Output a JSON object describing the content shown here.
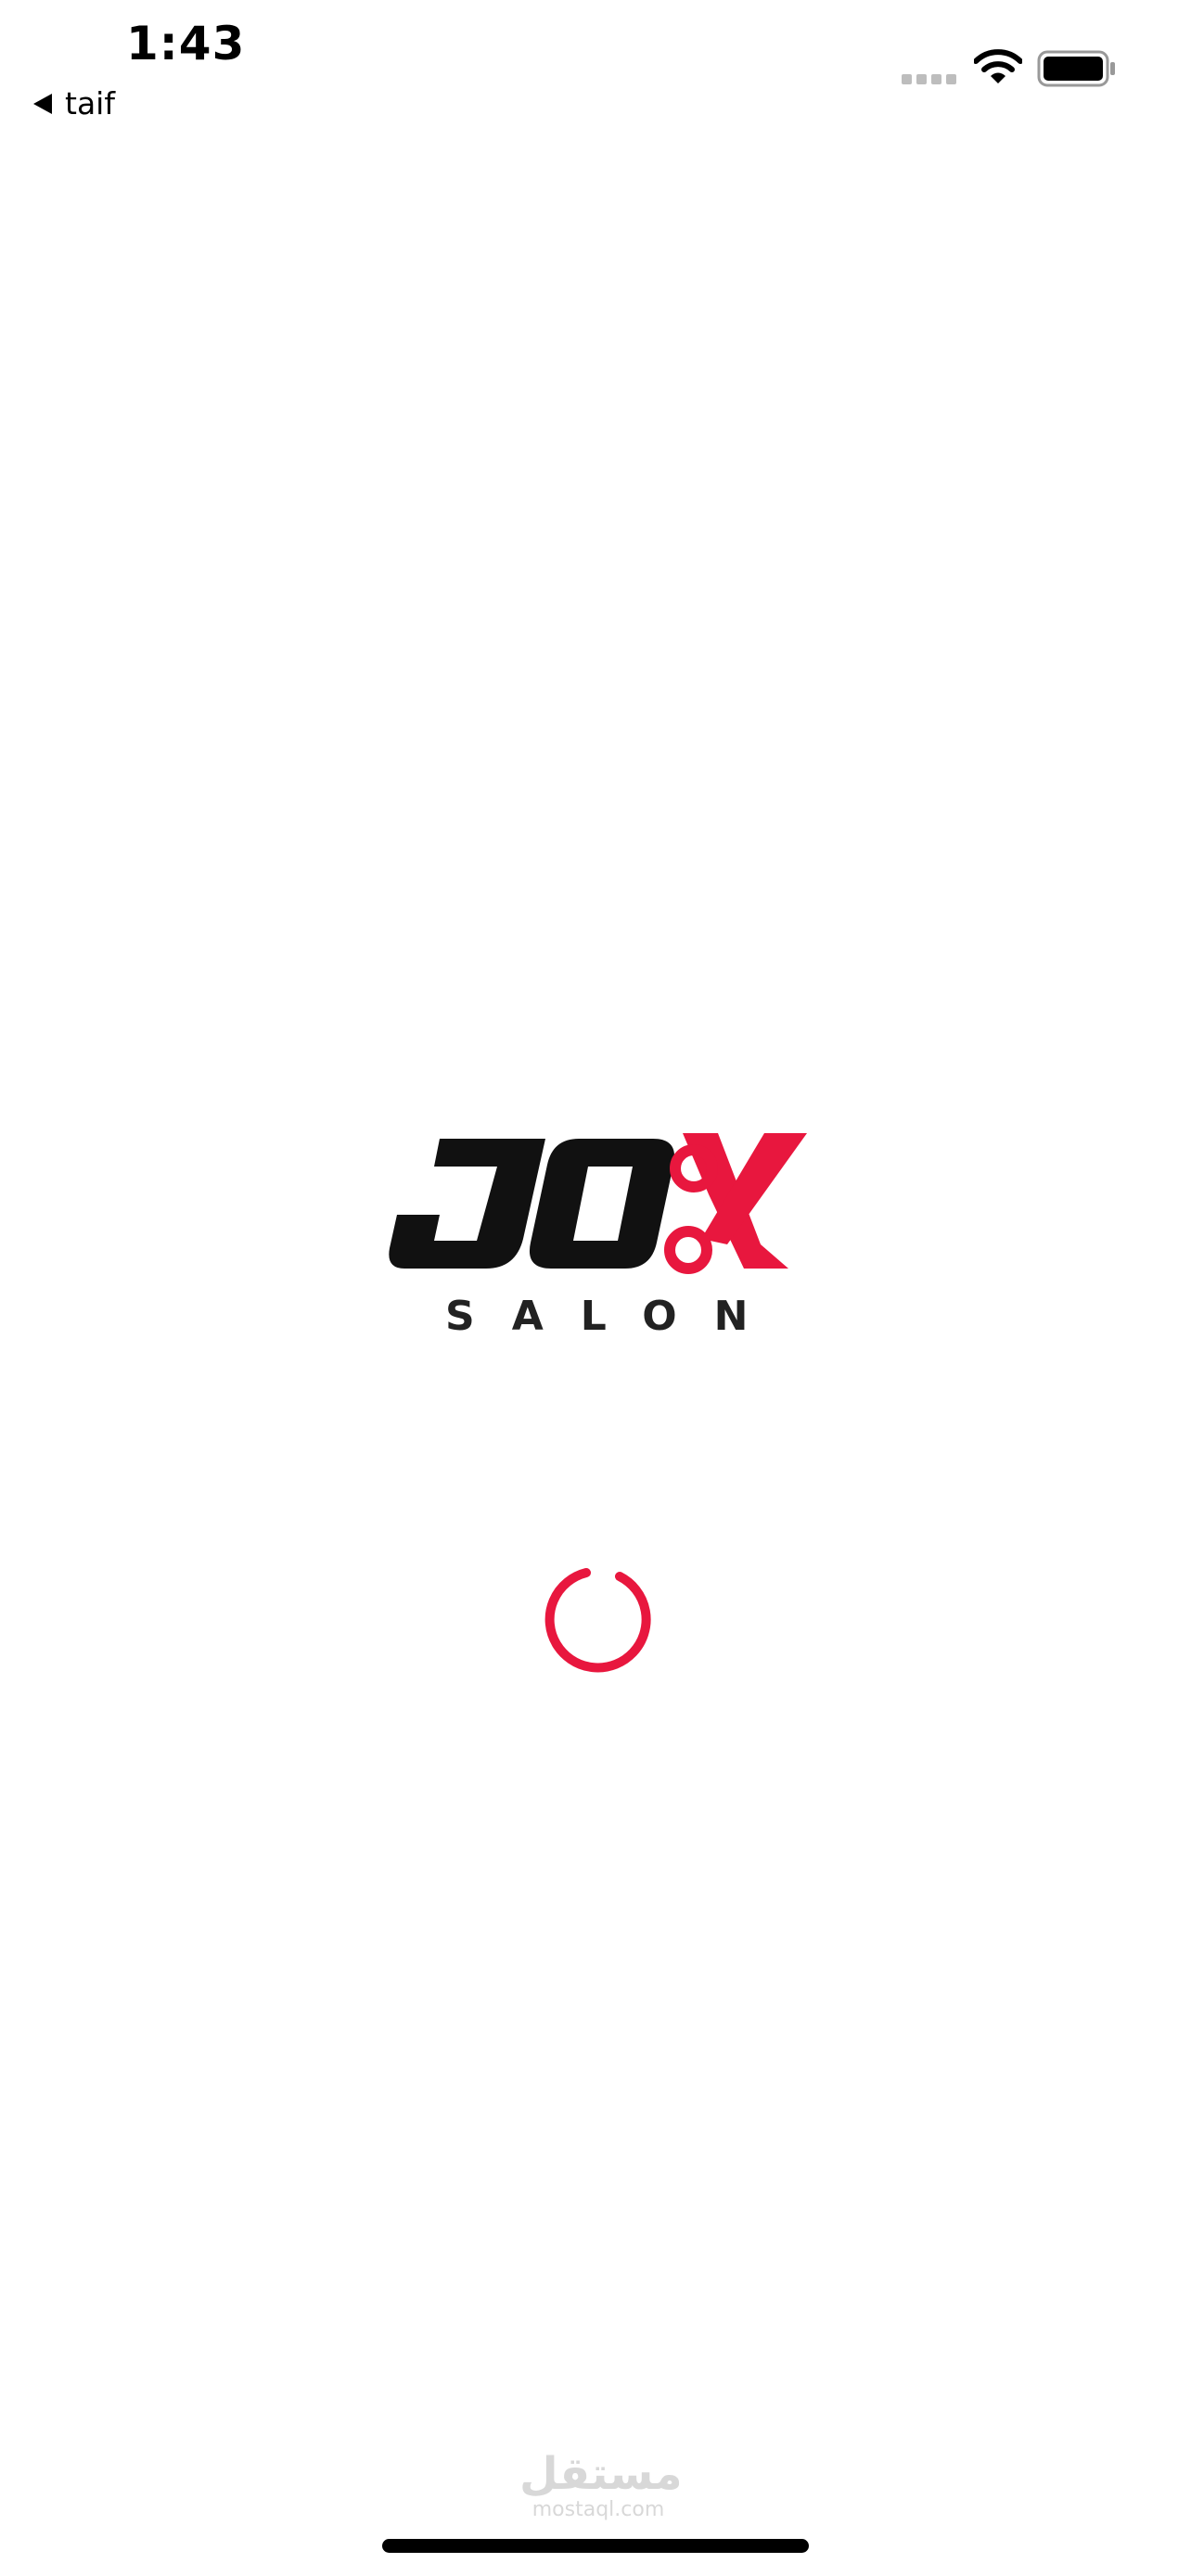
{
  "status_bar": {
    "time": "1:43",
    "back_app_label": "taif",
    "icons": [
      "signal-icon",
      "wifi-icon",
      "battery-icon"
    ]
  },
  "splash": {
    "logo_text": "JOX",
    "logo_subtext": "SALON",
    "loading": true
  },
  "watermark": {
    "arabic": "مستقل",
    "url": "mostaql.com"
  },
  "colors": {
    "brand_red": "#E8173E",
    "logo_black": "#111111",
    "background": "#FFFFFF"
  }
}
